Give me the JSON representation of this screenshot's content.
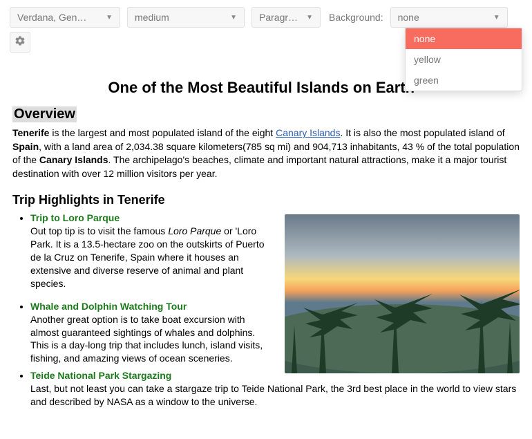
{
  "toolbar": {
    "font": {
      "value": "Verdana, Gen…"
    },
    "size": {
      "value": "medium"
    },
    "block": {
      "value": "Paragraph"
    },
    "bgLabel": "Background:",
    "bg": {
      "value": "none",
      "options": [
        "none",
        "yellow",
        "green"
      ]
    }
  },
  "content": {
    "title": "One of the Most Beautiful Islands on Earth -",
    "overviewHeading": "Overview",
    "intro": {
      "p1a": "Tenerife",
      "p1b": " is the largest and most populated island of the eight ",
      "linkText": "Canary Islands",
      "p1c": ". It is also the most populated island of ",
      "p1d": "Spain",
      "p1e": ", with a land area of 2,034.38 square kilometers(785 sq mi) and 904,713 inhabitants, 43 % of the total population of the ",
      "p1f": "Canary Islands",
      "p1g": ". The archipelago's beaches, climate and important natural attractions, make it a major tourist destination with over 12 million visitors per year."
    },
    "highlightsHeading": "Trip Highlights in Tenerife",
    "highlights": [
      {
        "title": "Trip to Loro Parque",
        "body": "Out top tip is to visit the famous Loro Parque or 'Loro Park. It is a 13.5-hectare zoo on the outskirts of Puerto de la Cruz on Tenerife, Spain where it houses an extensive and diverse reserve of animal and plant species.",
        "italic": "Loro Parque"
      },
      {
        "title": "Whale and Dolphin Watching Tour",
        "body": "Another great option is to take boat excursion with almost guaranteed sightings of whales and dolphins. This is a day-long trip that includes lunch, island visits, fishing, and amazing views of ocean sceneries."
      },
      {
        "title": "Teide National Park Stargazing",
        "body": "Last, but not least you can take a stargaze trip to Teide National Park, the 3rd best place in the world to view stars and described by NASA as a window to the universe."
      }
    ]
  }
}
